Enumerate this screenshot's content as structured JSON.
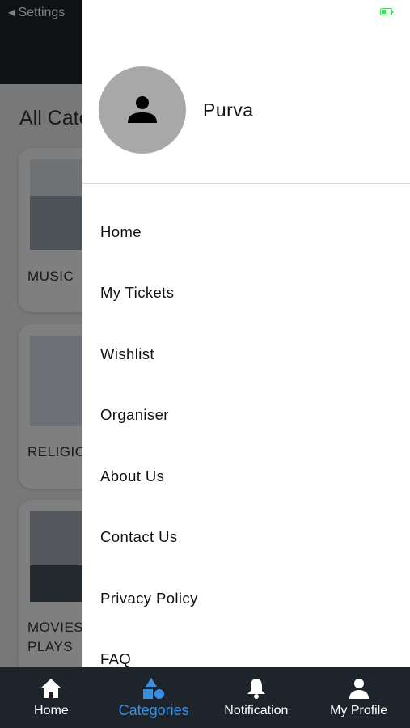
{
  "status_bar": {
    "back_label": "◂ Settings"
  },
  "background": {
    "title": "All Categories",
    "categories": [
      {
        "label": "MUSIC"
      },
      {
        "label": "RELIGIOUS"
      },
      {
        "label": "MOVIES &\nPLAYS"
      }
    ]
  },
  "drawer": {
    "user_name": "Purva",
    "menu": [
      {
        "label": "Home"
      },
      {
        "label": "My Tickets"
      },
      {
        "label": "Wishlist"
      },
      {
        "label": "Organiser"
      },
      {
        "label": "About Us"
      },
      {
        "label": "Contact Us"
      },
      {
        "label": "Privacy Policy"
      },
      {
        "label": "FAQ"
      }
    ]
  },
  "bottom_nav": {
    "items": [
      {
        "label": "Home",
        "icon": "home-icon"
      },
      {
        "label": "Categories",
        "icon": "categories-icon",
        "active": true
      },
      {
        "label": "Notification",
        "icon": "bell-icon"
      },
      {
        "label": "My Profile",
        "icon": "person-icon"
      }
    ]
  },
  "colors": {
    "nav_bg": "#1e242b",
    "accent": "#3a8fe0",
    "avatar_bg": "#a8a8a8",
    "battery": "#4cd964"
  }
}
